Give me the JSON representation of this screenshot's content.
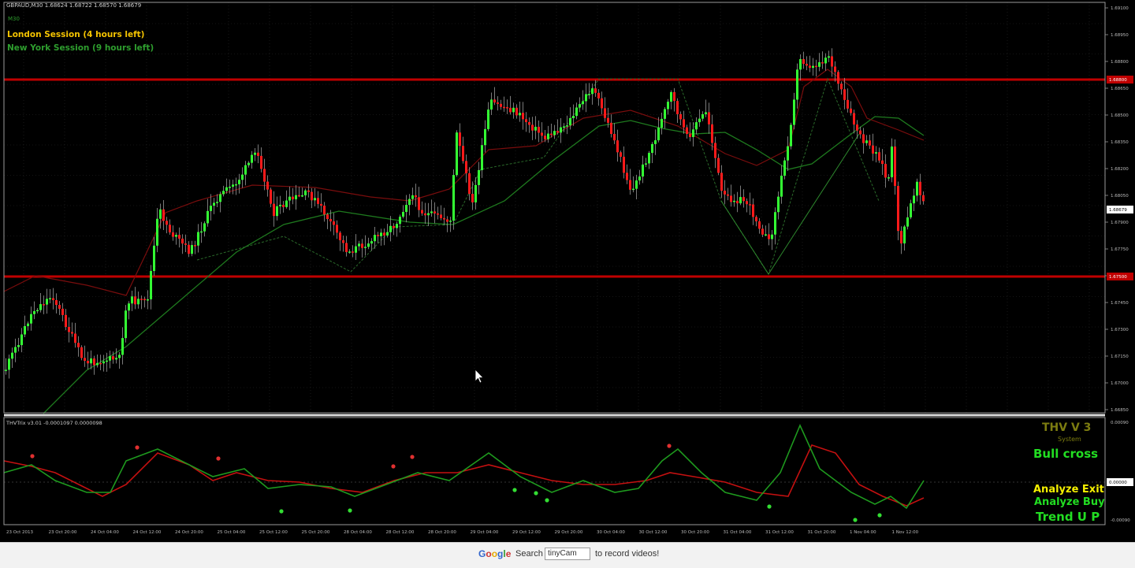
{
  "symbol_header": "GBPAUD,M30  1.68624 1.68722 1.68570 1.68679",
  "symbol_sub": "M30",
  "sessions": [
    {
      "label": "London Session (4 hours left)",
      "color": "#f5c400"
    },
    {
      "label": "New York Session (9 hours left)",
      "color": "#2e9e2e"
    }
  ],
  "price_axis": {
    "labels": [
      "1.69100",
      "1.68950",
      "1.68800",
      "1.68650",
      "1.68500",
      "1.68350",
      "1.68200",
      "1.68050",
      "1.67900",
      "1.67750",
      "1.67600",
      "1.67450",
      "1.67300",
      "1.67150",
      "1.67000",
      "1.66850"
    ],
    "resistance_tag": "1.68800",
    "current_tag": "1.68679",
    "support_tag": "1.67500"
  },
  "indicator": {
    "header": "THVTrix v3.01  -0.0001097 0.0000098",
    "axis_labels": [
      "0.00090",
      "0.00000",
      "-0.00090"
    ],
    "zero_tag": "0.00000",
    "thv_title": "THV V 3",
    "thv_subtitle": "System",
    "cross_status": "Bull cross",
    "analyze_exit": "Analyze Exit",
    "analyze_buy": "Analyze Buy",
    "trend": "Trend U P"
  },
  "time_axis": [
    "23 Oct 2013",
    "23 Oct 20:00",
    "24 Oct 04:00",
    "24 Oct 12:00",
    "24 Oct 20:00",
    "25 Oct 04:00",
    "25 Oct 12:00",
    "25 Oct 20:00",
    "28 Oct 04:00",
    "28 Oct 12:00",
    "28 Oct 20:00",
    "29 Oct 04:00",
    "29 Oct 12:00",
    "29 Oct 20:00",
    "30 Oct 04:00",
    "30 Oct 12:00",
    "30 Oct 20:00",
    "31 Oct 04:00",
    "31 Oct 12:00",
    "31 Oct 20:00",
    "1 Nov 04:00",
    "1 Nov 12:00"
  ],
  "colors": {
    "bull_candle": "#33ff33",
    "bear_candle": "#ff1a1a",
    "sr_line": "#c00000",
    "grid": "#2a2a2a",
    "axis_text": "#bbbbbb",
    "yellow": "#f5f000",
    "green": "#22dd22"
  },
  "icons": {
    "cursor": "arrow-cursor-icon"
  },
  "bottom_bar": {
    "google_logo": "Google",
    "search_label": "Search",
    "search_value": "tinyCam",
    "record_text": "to record videos!"
  }
}
